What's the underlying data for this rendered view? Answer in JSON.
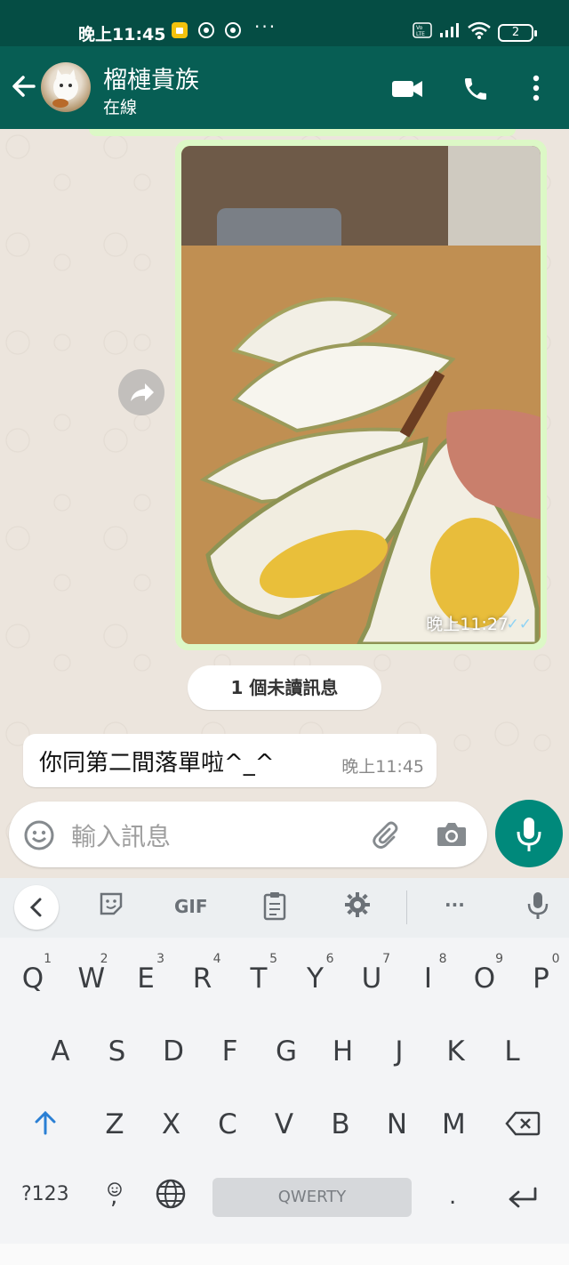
{
  "status_bar": {
    "time": "晚上11:45",
    "more": "···",
    "battery": "2"
  },
  "header": {
    "contact_name": "榴槤貴族",
    "presence": "在線"
  },
  "chat": {
    "image_message": {
      "time": "晚上11:27",
      "ticks": "✓✓"
    },
    "unread_banner": "1 個未讀訊息",
    "text_message": {
      "text": "你同第二間落單啦^_^",
      "time": "晚上11:45"
    }
  },
  "composer": {
    "placeholder": "輸入訊息"
  },
  "keyboard": {
    "toolbar": {
      "gif_label": "GIF",
      "more": "···"
    },
    "row1": [
      {
        "key": "Q",
        "hint": "1"
      },
      {
        "key": "W",
        "hint": "2"
      },
      {
        "key": "E",
        "hint": "3"
      },
      {
        "key": "R",
        "hint": "4"
      },
      {
        "key": "T",
        "hint": "5"
      },
      {
        "key": "Y",
        "hint": "6"
      },
      {
        "key": "U",
        "hint": "7"
      },
      {
        "key": "I",
        "hint": "8"
      },
      {
        "key": "O",
        "hint": "9"
      },
      {
        "key": "P",
        "hint": "0"
      }
    ],
    "row2": [
      "A",
      "S",
      "D",
      "F",
      "G",
      "H",
      "J",
      "K",
      "L"
    ],
    "row3": [
      "Z",
      "X",
      "C",
      "V",
      "B",
      "N",
      "M"
    ],
    "symbols_key": "?123",
    "comma_key": ",",
    "space_label": "QWERTY",
    "period_key": "."
  },
  "colors": {
    "status_bar": "#054d44",
    "header": "#075e54",
    "outgoing_bubble": "#dcf8c6",
    "incoming_bubble": "#ffffff",
    "mic_button": "#00897b",
    "read_ticks": "#8fd3f4"
  },
  "icons": {
    "back": "arrow-left-icon",
    "video": "video-camera-icon",
    "call": "phone-icon",
    "menu": "more-vert-icon",
    "forward": "forward-icon",
    "emoji": "emoji-icon",
    "attach": "paperclip-icon",
    "camera": "camera-icon",
    "mic": "microphone-icon"
  }
}
